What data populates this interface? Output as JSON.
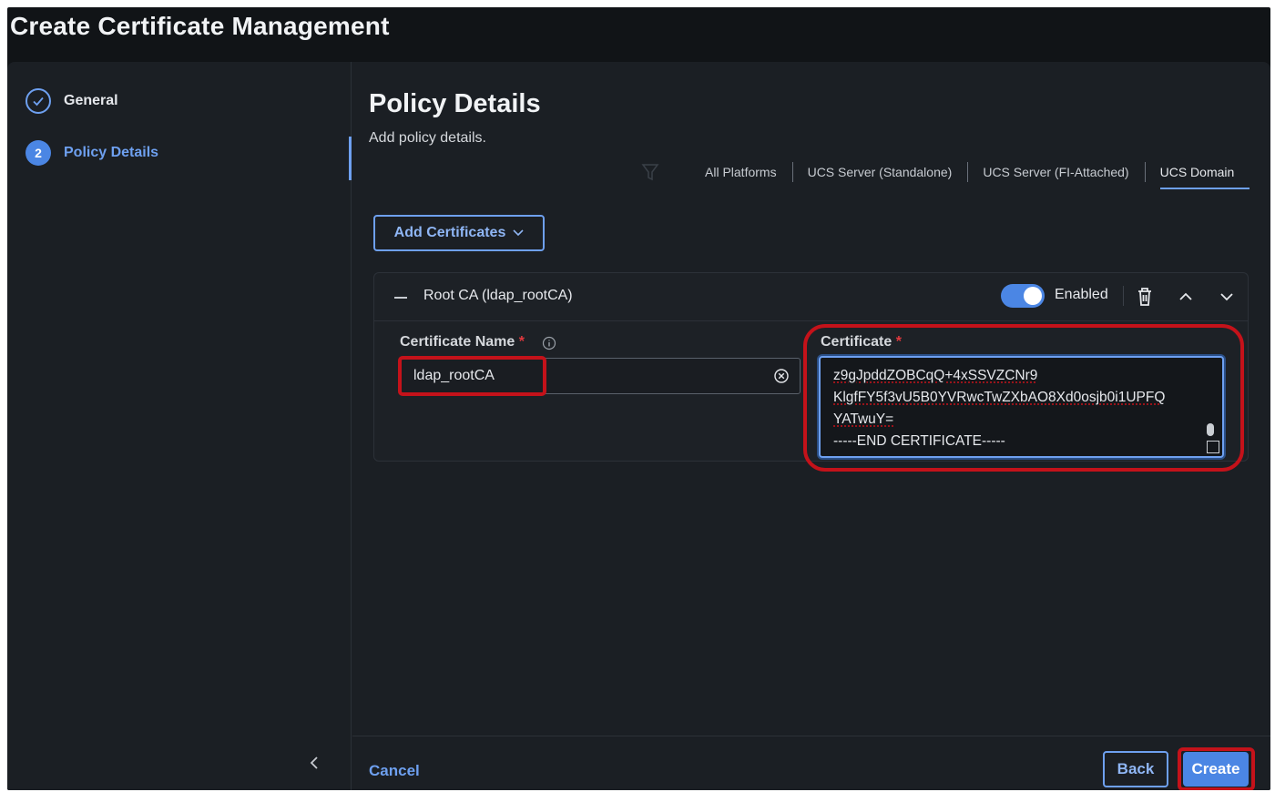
{
  "page": {
    "title": "Create Certificate Management"
  },
  "stepper": {
    "steps": [
      {
        "number": "1",
        "label": "General",
        "state": "completed"
      },
      {
        "number": "2",
        "label": "Policy Details",
        "state": "active"
      }
    ],
    "collapse_icon": "chevron-left-icon"
  },
  "section": {
    "title": "Policy Details",
    "subtitle": "Add policy details."
  },
  "platform_filter": {
    "icon": "filter-icon",
    "tabs": [
      "All Platforms",
      "UCS Server (Standalone)",
      "UCS Server (FI-Attached)",
      "UCS Domain"
    ],
    "selected": "UCS Domain"
  },
  "add_certificates": {
    "label": "Add Certificates"
  },
  "certificate_item": {
    "title": "Root CA (ldap_rootCA)",
    "enabled_label": "Enabled",
    "enabled": true,
    "certificate_name": {
      "label": "Certificate Name",
      "required_mark": "*",
      "value": "ldap_rootCA"
    },
    "certificate": {
      "label": "Certificate",
      "required_mark": "*",
      "lines": [
        "z9gJpddZOBCqQ+4xSSVZCNr9",
        "KlgfFY5f3vU5B0YVRwcTwZXbAO8Xd0osjb0i1UPFQ",
        "YATwuY=",
        "-----END CERTIFICATE-----"
      ]
    }
  },
  "footer": {
    "cancel_label": "Cancel",
    "back_label": "Back",
    "create_label": "Create"
  },
  "colors": {
    "accent": "#4b86e4",
    "highlight": "#c4121a",
    "background": "#1b1f24"
  }
}
